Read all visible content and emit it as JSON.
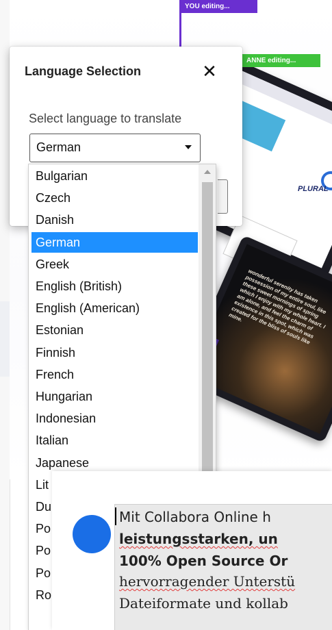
{
  "dialog": {
    "title": "Language Selection",
    "close_glyph": "✕",
    "label": "Select language to translate",
    "selected": "German"
  },
  "dropdown": {
    "options": [
      "Bulgarian",
      "Czech",
      "Danish",
      "German",
      "Greek",
      "English (British)",
      "English (American)",
      "Estonian",
      "Finnish",
      "French",
      "Hungarian",
      "Indonesian",
      "Italian",
      "Japanese",
      "Lit",
      "Du",
      "Po",
      "Po",
      "Po",
      "Ro"
    ],
    "selected_index": 3
  },
  "background": {
    "you_tag": "YOU editing...",
    "anne_tag": "ANNE editing...",
    "plural": "PLURAL",
    "photo_text": "wonderful serenity has taken possession of my entire soul, like these sweet mornings of spring which I enjoy with my whole heart. I am alone, and feel the charm of existence in this spot, which was created for the bliss of souls like mine."
  },
  "doc": {
    "line1": "Mit Collabora Online h",
    "line2": "leistungsstarken, un",
    "line3": "100% Open Source Or",
    "line4": "hervorragender Unterstü",
    "line5": "Dateiformate und kollab"
  },
  "colors": {
    "you_tag": "#6a2fd0",
    "anne_tag": "#3ec23b",
    "selection": "#1e90ff",
    "blue_dot": "#1a6ee6"
  }
}
